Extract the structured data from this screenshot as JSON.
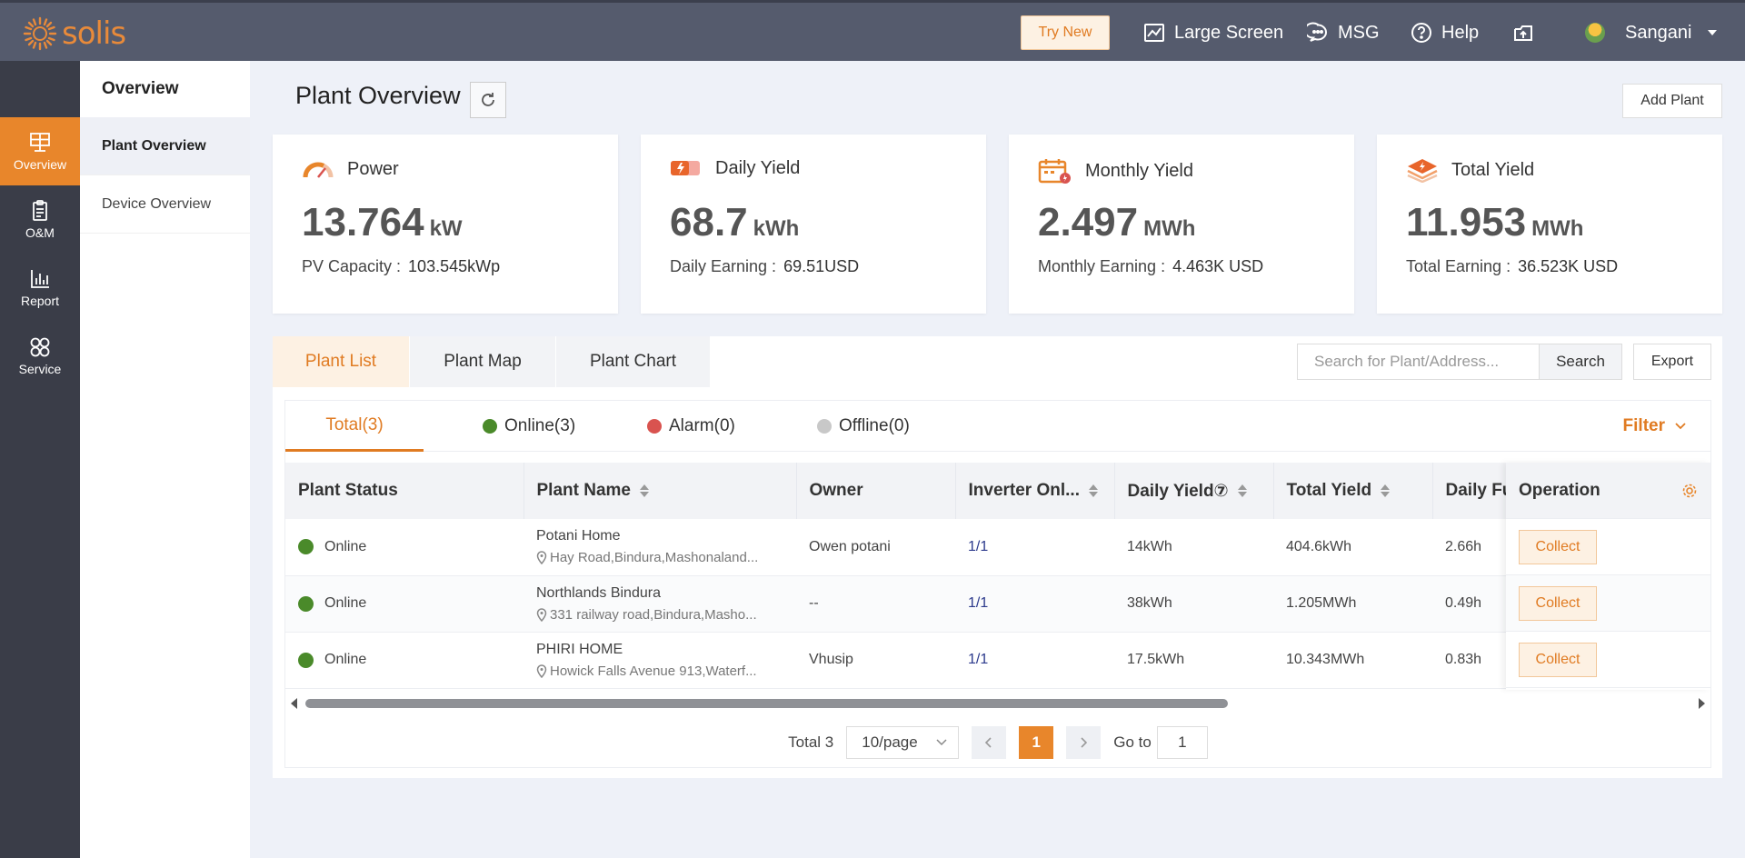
{
  "brand": {
    "name": "solis",
    "color": "#e88a3a"
  },
  "topbar": {
    "try_new": "Try New",
    "large_screen": "Large Screen",
    "msg": "MSG",
    "help": "Help",
    "user": "Sangani"
  },
  "iconnav": [
    {
      "label": "Overview",
      "icon": "solar-panel-icon",
      "active": true
    },
    {
      "label": "O&M",
      "icon": "clipboard-icon"
    },
    {
      "label": "Report",
      "icon": "bar-chart-icon"
    },
    {
      "label": "Service",
      "icon": "grid-circles-icon"
    }
  ],
  "submenu": {
    "title": "Overview",
    "items": [
      {
        "label": "Plant Overview",
        "active": true
      },
      {
        "label": "Device Overview"
      }
    ]
  },
  "page": {
    "title": "Plant Overview",
    "add_plant": "Add Plant"
  },
  "cards": [
    {
      "title": "Power",
      "icon": "gauge-icon",
      "value": "13.764",
      "unit": "kW",
      "sub_label": "PV Capacity :",
      "sub_value": "103.545kWp"
    },
    {
      "title": "Daily Yield",
      "icon": "battery-icon",
      "value": "68.7",
      "unit": "kWh",
      "sub_label": "Daily Earning :",
      "sub_value": "69.51USD"
    },
    {
      "title": "Monthly Yield",
      "icon": "calendar-icon",
      "value": "2.497",
      "unit": "MWh",
      "sub_label": "Monthly Earning :",
      "sub_value": "4.463K USD"
    },
    {
      "title": "Total Yield",
      "icon": "layers-icon",
      "value": "11.953",
      "unit": "MWh",
      "sub_label": "Total Earning :",
      "sub_value": "36.523K USD"
    }
  ],
  "tabs": [
    "Plant List",
    "Plant Map",
    "Plant Chart"
  ],
  "search": {
    "placeholder": "Search for Plant/Address...",
    "button": "Search",
    "export": "Export"
  },
  "status_tabs": {
    "total": "Total(3)",
    "online": "Online(3)",
    "alarm": "Alarm(0)",
    "offline": "Offline(0)",
    "filter": "Filter"
  },
  "status_colors": {
    "online": "#4a8a2a",
    "alarm": "#d9534f",
    "offline": "#c8c8c8",
    "accent": "#e8862b"
  },
  "table": {
    "headers": {
      "status": "Plant Status",
      "name": "Plant Name",
      "owner": "Owner",
      "inverter": "Inverter Onl...",
      "daily": "Daily Yield⑦",
      "total": "Total Yield",
      "fullhours": "Daily Fu",
      "operation": "Operation"
    },
    "rows": [
      {
        "status": "Online",
        "name": "Potani Home",
        "address": "Hay Road,Bindura,Mashonaland...",
        "owner": "Owen potani",
        "inverter": "1/1",
        "daily": "14kWh",
        "total": "404.6kWh",
        "fullhours": "2.66h",
        "action": "Collect"
      },
      {
        "status": "Online",
        "name": "Northlands Bindura",
        "address": "331 railway road,Bindura,Masho...",
        "owner": "--",
        "inverter": "1/1",
        "daily": "38kWh",
        "total": "1.205MWh",
        "fullhours": "0.49h",
        "action": "Collect"
      },
      {
        "status": "Online",
        "name": "PHIRI HOME",
        "address": "Howick Falls Avenue 913,Waterf...",
        "owner": "Vhusip",
        "inverter": "1/1",
        "daily": "17.5kWh",
        "total": "10.343MWh",
        "fullhours": "0.83h",
        "action": "Collect"
      }
    ]
  },
  "pager": {
    "total": "Total 3",
    "page_size": "10/page",
    "current": "1",
    "goto_label": "Go to",
    "goto_value": "1"
  }
}
